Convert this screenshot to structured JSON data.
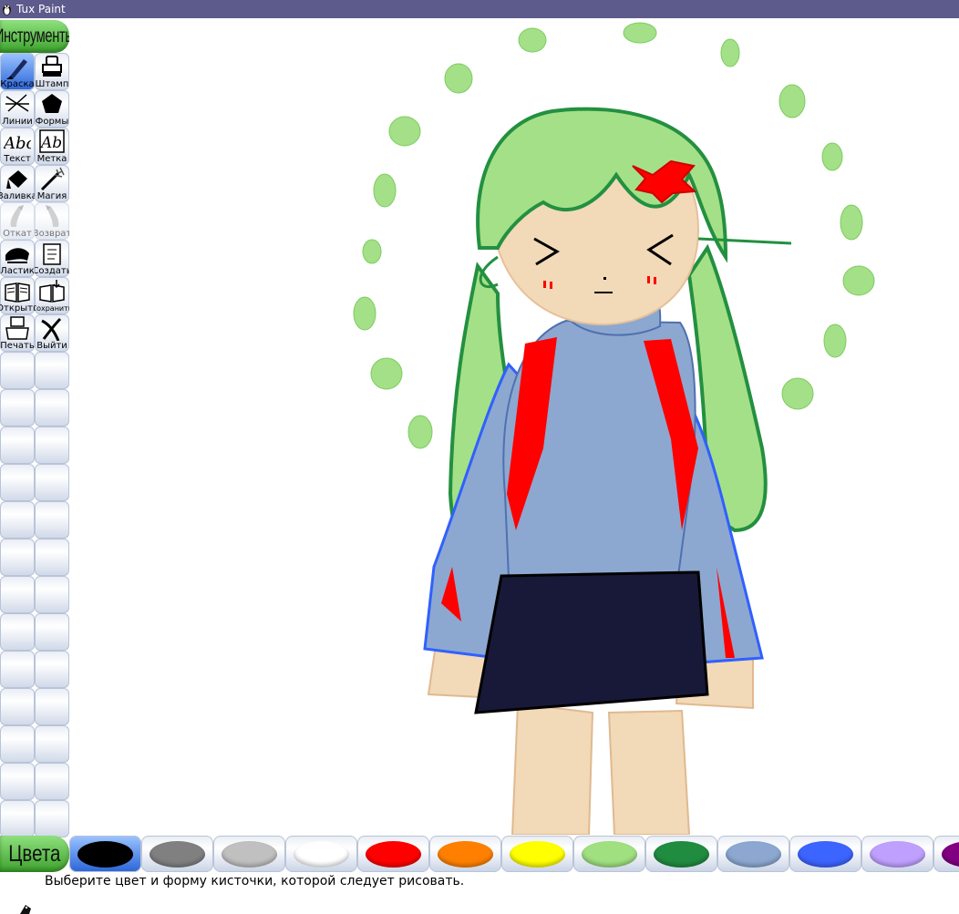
{
  "window": {
    "title": "Tux Paint"
  },
  "tools": {
    "header": "Инструменты",
    "items": [
      {
        "name": "paint",
        "label": "Краска",
        "icon": "brush-icon",
        "active": true
      },
      {
        "name": "stamp",
        "label": "Штамп",
        "icon": "stamp-icon"
      },
      {
        "name": "lines",
        "label": "Линии",
        "icon": "lines-icon"
      },
      {
        "name": "shapes",
        "label": "Формы",
        "icon": "pentagon-icon"
      },
      {
        "name": "text",
        "label": "Текст",
        "icon": "text-abc-icon"
      },
      {
        "name": "label",
        "label": "Метка",
        "icon": "label-ab-icon"
      },
      {
        "name": "fill",
        "label": "Заливка",
        "icon": "fill-bucket-icon"
      },
      {
        "name": "magic",
        "label": "Магия",
        "icon": "magic-wand-icon"
      },
      {
        "name": "undo",
        "label": "Откат",
        "icon": "undo-icon",
        "disabled": true
      },
      {
        "name": "redo",
        "label": "Возврат",
        "icon": "redo-icon",
        "disabled": true
      },
      {
        "name": "eraser",
        "label": "Ластик",
        "icon": "eraser-icon"
      },
      {
        "name": "new",
        "label": "Создать",
        "icon": "new-page-icon"
      },
      {
        "name": "open",
        "label": "Открыть",
        "icon": "open-book-icon"
      },
      {
        "name": "save",
        "label": "Сохранить",
        "icon": "save-icon"
      },
      {
        "name": "print",
        "label": "Печать",
        "icon": "printer-icon"
      },
      {
        "name": "quit",
        "label": "Выйти",
        "icon": "quit-icon"
      }
    ]
  },
  "colors": {
    "header": "Цвета",
    "selected_index": 0,
    "swatches": [
      "#000000",
      "#808080",
      "#c0c0c0",
      "#ffffff",
      "#ff0000",
      "#ff8000",
      "#ffff00",
      "#a0e080",
      "#208c40",
      "#8ca8d0",
      "#3c64ff",
      "#c0a0ff",
      "#800080"
    ]
  },
  "status": {
    "message": "Выберите цвет и форму кисточки, которой следует рисовать."
  }
}
